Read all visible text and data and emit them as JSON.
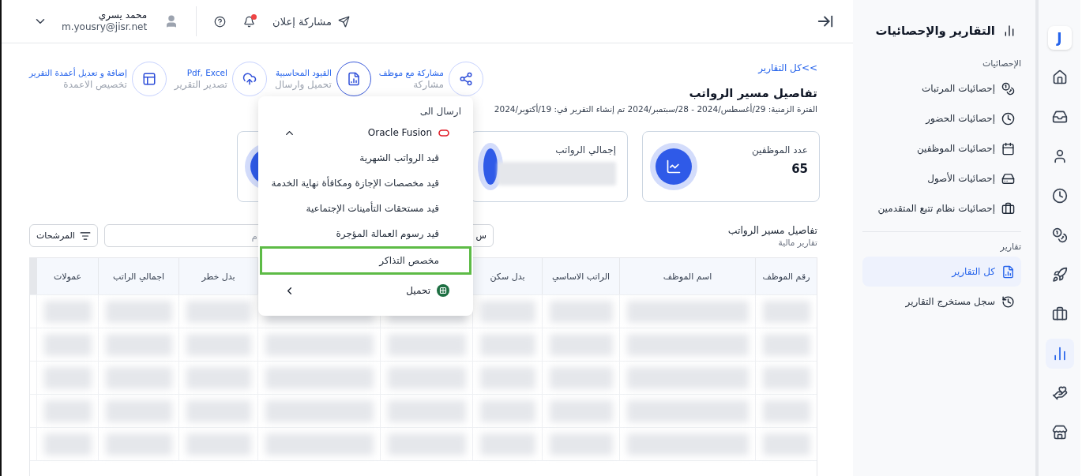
{
  "topbar": {
    "user_name": "محمد يسري",
    "user_email": "m.yousry@jisr.net",
    "announce_label": "مشاركة إعلان",
    "notifications_unread": true
  },
  "back_link": {
    "arrows": "<<",
    "label": "كل التقارير"
  },
  "report": {
    "title": "تفاصيل مسير الرواتب",
    "period": "الفترة الزمنية: 29/أغسطس/2024 - 28/سبتمبر/2024 تم إنشاء التقرير في: 19/أكتوبر/2024"
  },
  "actions": [
    {
      "kind": "share",
      "title": "مشاركة مع موظف",
      "subtitle": "مشاركة",
      "active": false
    },
    {
      "kind": "accounting",
      "title": "القيود المحاسبية",
      "subtitle": "تحميل وارسال",
      "active": true
    },
    {
      "kind": "export",
      "title": "Pdf, Excel",
      "subtitle": "تصدير التقرير",
      "active": false
    },
    {
      "kind": "columns",
      "title": "إضافة و تعديل أعمدة التقرير",
      "subtitle": "تخصيص الاعمدة",
      "active": false
    }
  ],
  "cards": [
    {
      "kind": "number",
      "label": "عدد الموظفين",
      "value": "65"
    },
    {
      "kind": "redacted",
      "label": "إجمالي الرواتب"
    },
    {
      "kind": "covered"
    }
  ],
  "table_section": {
    "title": "تفاصيل مسير الرواتب",
    "subtitle": "تقارير مالية",
    "filter_label": "المرشحات",
    "search_placeholder": "م",
    "search_button": "س"
  },
  "table": {
    "columns": [
      {
        "label": "رقم الموظف"
      },
      {
        "label": "اسم الموظف"
      },
      {
        "label": "الراتب الاساسي"
      },
      {
        "label": "بدل سكن"
      },
      {
        "label": "بدل خطر"
      },
      {
        "label": "اجمالي الراتب"
      },
      {
        "label": "عمولات"
      }
    ]
  },
  "send_menu": {
    "heading": "ارسال الى",
    "group": {
      "label": "Oracle Fusion",
      "expanded": true,
      "items": [
        {
          "label": "قيد الرواتب الشهرية",
          "selected": false
        },
        {
          "label": "قيد مخصصات الإجازة ومكافأة نهاية الخدمة",
          "selected": false
        },
        {
          "label": "قيد مستحقات التأمينات الإجتماعية",
          "selected": false
        },
        {
          "label": "قيد رسوم العمالة المؤجرة",
          "selected": false
        },
        {
          "label": "مخصص التذاكر",
          "selected": true
        }
      ]
    },
    "download": {
      "label": "تحميل",
      "expanded": false
    }
  },
  "sidebar": {
    "title": "التقارير والإحصائيات",
    "sections": [
      {
        "label": "الإحصائيات",
        "items": [
          {
            "label": "إحصائيات المرتبات",
            "selected": false
          },
          {
            "label": "إحصائيات الحضور",
            "selected": false
          },
          {
            "label": "إحصائيات الموظفين",
            "selected": false
          },
          {
            "label": "إحصائيات الأصول",
            "selected": false
          },
          {
            "label": "إحصائيات نظام تتبع المتقدمين",
            "selected": false
          }
        ]
      },
      {
        "label": "تقارير",
        "items": [
          {
            "label": "كل التقارير",
            "selected": true
          },
          {
            "label": "سجل مستخرج التقارير",
            "selected": false
          }
        ]
      }
    ]
  },
  "rail": {
    "logo": "J",
    "items": [
      {
        "selected": false
      },
      {
        "selected": false
      },
      {
        "selected": false
      },
      {
        "selected": false
      },
      {
        "selected": false
      },
      {
        "selected": false
      },
      {
        "selected": false
      },
      {
        "selected": true
      },
      {
        "selected": false
      },
      {
        "selected": false
      }
    ]
  }
}
